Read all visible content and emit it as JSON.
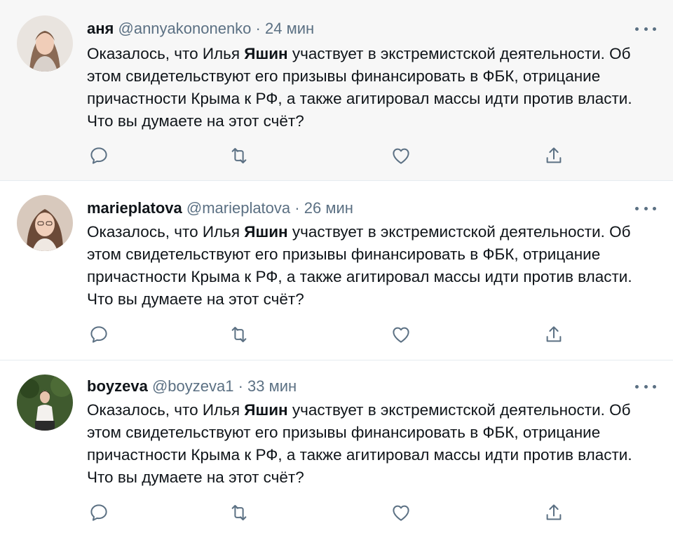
{
  "tweets": [
    {
      "name": "аня",
      "handle": "@annyakononenko",
      "separator": "·",
      "time": "24 мин",
      "text_before": "Оказалось, что Илья ",
      "text_bold": "Яшин",
      "text_after": " участвует в экстремистской деятельности. Об этом свидетельствуют его призывы финансировать в ФБК, отрицание причастности Крыма к РФ, а также агитировал массы идти против власти. Что вы думаете на этот счёт?"
    },
    {
      "name": "marieplatova",
      "handle": "@marieplatova",
      "separator": "·",
      "time": "26 мин",
      "text_before": "Оказалось, что Илья ",
      "text_bold": "Яшин",
      "text_after": " участвует в экстремистской деятельности. Об этом свидетельствуют его призывы финансировать в ФБК, отрицание причастности Крыма к РФ, а также агитировал массы идти против власти. Что вы думаете на этот счёт?"
    },
    {
      "name": "boyzeva",
      "handle": "@boyzeva1",
      "separator": "·",
      "time": "33 мин",
      "text_before": "Оказалось, что Илья ",
      "text_bold": "Яшин",
      "text_after": " участвует в экстремистской деятельности. Об этом свидетельствуют его призывы финансировать в ФБК, отрицание причастности Крыма к РФ, а также агитировал массы идти против власти. Что вы думаете на этот счёт?"
    }
  ],
  "icons": {
    "reply": "reply-icon",
    "retweet": "retweet-icon",
    "like": "like-icon",
    "share": "share-icon",
    "more": "more-icon"
  },
  "colors": {
    "text": "#0f1419",
    "secondary": "#5b7083",
    "highlight_background": "#f7f7f7",
    "divider": "#e6ecf0"
  }
}
